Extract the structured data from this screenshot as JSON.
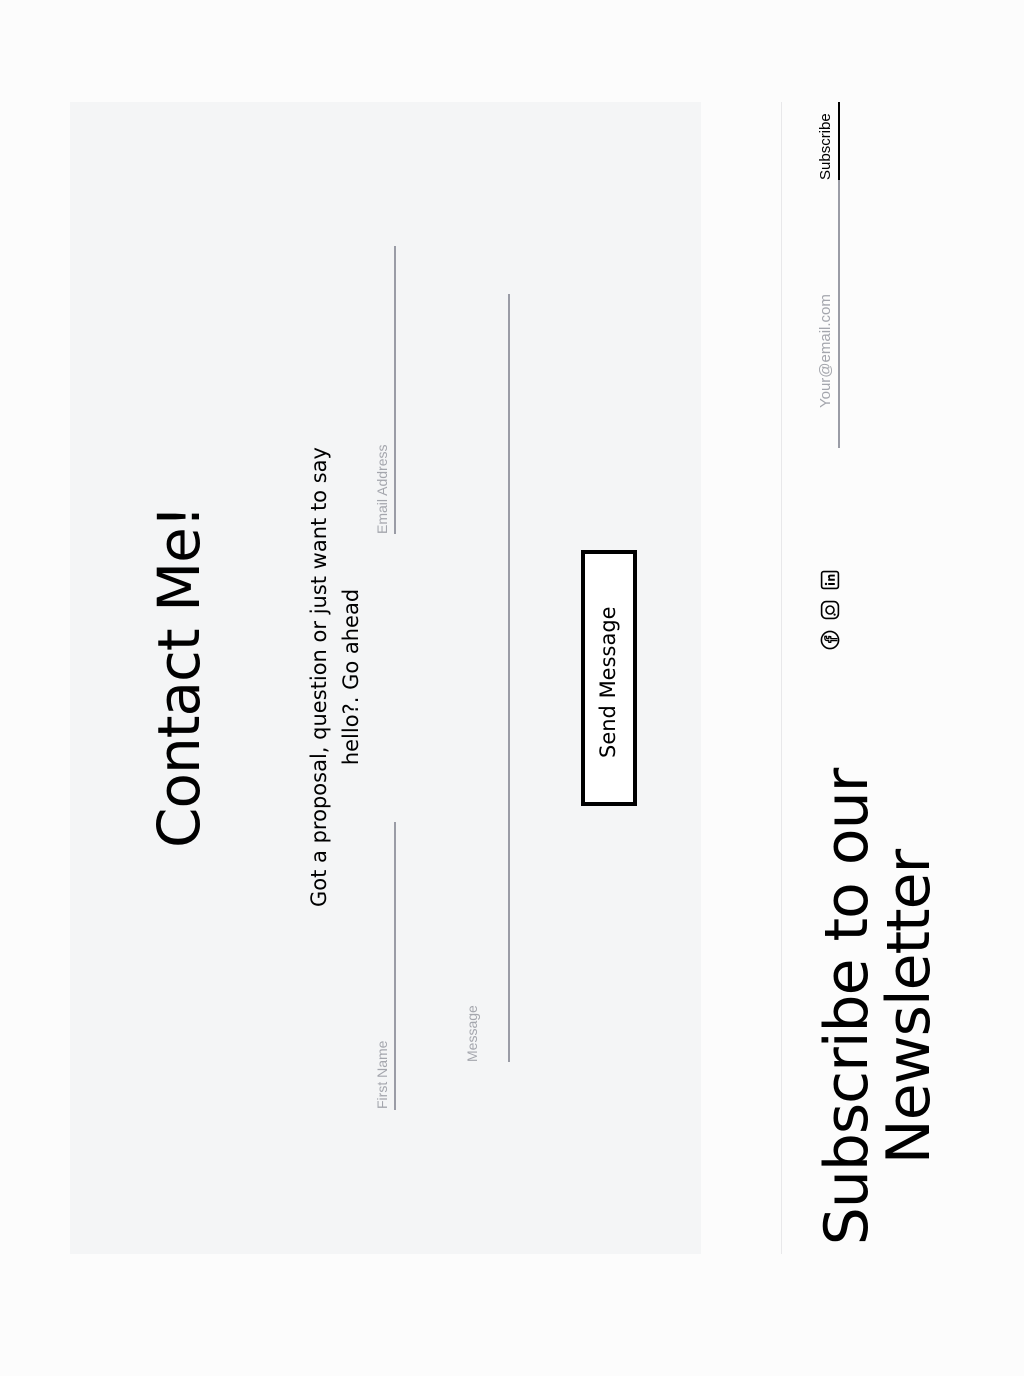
{
  "contact": {
    "title": "Contact Me!",
    "subtitle": "Got a proposal, question or just want to say hello?. Go ahead",
    "fields": {
      "first_name": "First Name",
      "email": "Email Address",
      "message": "Message"
    },
    "send_label": "Send Message"
  },
  "newsletter": {
    "title": "Subscribe to our Newsletter",
    "email_placeholder": "Your@email.com",
    "subscribe_label": "Subscribe"
  },
  "social": {
    "icons": [
      "facebook-icon",
      "instagram-icon",
      "linkedin-icon"
    ]
  },
  "colors": {
    "panel_bg": "#f4f5f6",
    "placeholder": "#a4a6ad",
    "line": "#9a9ca6",
    "text": "#000000"
  }
}
